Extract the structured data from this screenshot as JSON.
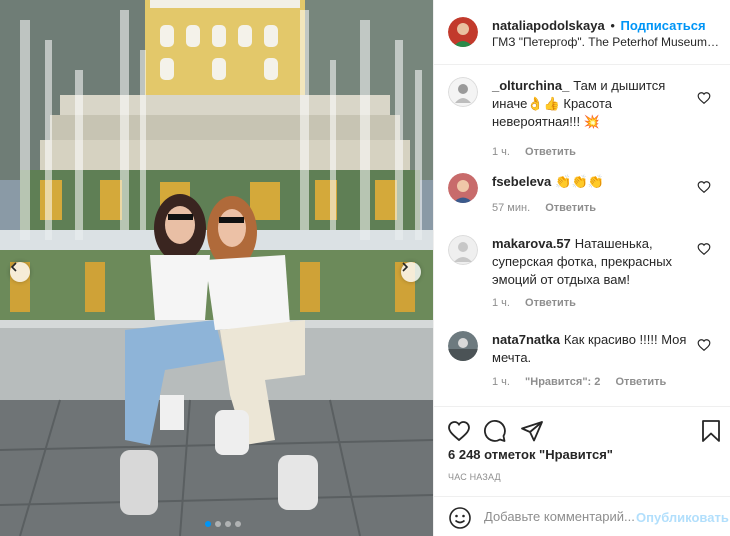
{
  "post": {
    "username": "nataliapodolskaya",
    "separator": "•",
    "follow_label": "Подписаться",
    "location": "ГМЗ \"Петергоф\". The Peterhof Museum Reserve"
  },
  "comments": [
    {
      "user": "_olturchina_",
      "text": "Там и дышится иначе👌👍 Красота невероятная!!! 💥",
      "time": "1 ч.",
      "reply": "Ответить"
    },
    {
      "user": "fsebeleva",
      "text": "👏👏👏",
      "time": "57 мин.",
      "reply": "Ответить"
    },
    {
      "user": "makarova.57",
      "text": "Наташенька, суперская фотка, прекрасных эмоций от отдыха вам!",
      "time": "1 ч.",
      "reply": "Ответить"
    },
    {
      "user": "nata7natka",
      "text": "Как красиво !!!!! Моя мечта.",
      "time": "1 ч.",
      "likes": "\"Нравится\": 2",
      "reply": "Ответить"
    }
  ],
  "actions": {
    "likes_text": "6 248 отметок \"Нравится\"",
    "time_ago": "ЧАС НАЗАД"
  },
  "add_comment": {
    "placeholder": "Добавьте комментарий...",
    "publish_label": "Опубликовать"
  },
  "icons": {
    "like": "heart-icon",
    "comment": "comment-icon",
    "share": "paper-plane-icon",
    "save": "bookmark-icon",
    "emoji": "smiley-icon",
    "prev": "chevron-left-icon",
    "next": "chevron-right-icon"
  },
  "colors": {
    "accent": "#0095f6",
    "muted": "#8e8e8e",
    "publish_disabled": "#b2dffc"
  },
  "carousel": {
    "slide_count": 4,
    "active_index": 0
  }
}
